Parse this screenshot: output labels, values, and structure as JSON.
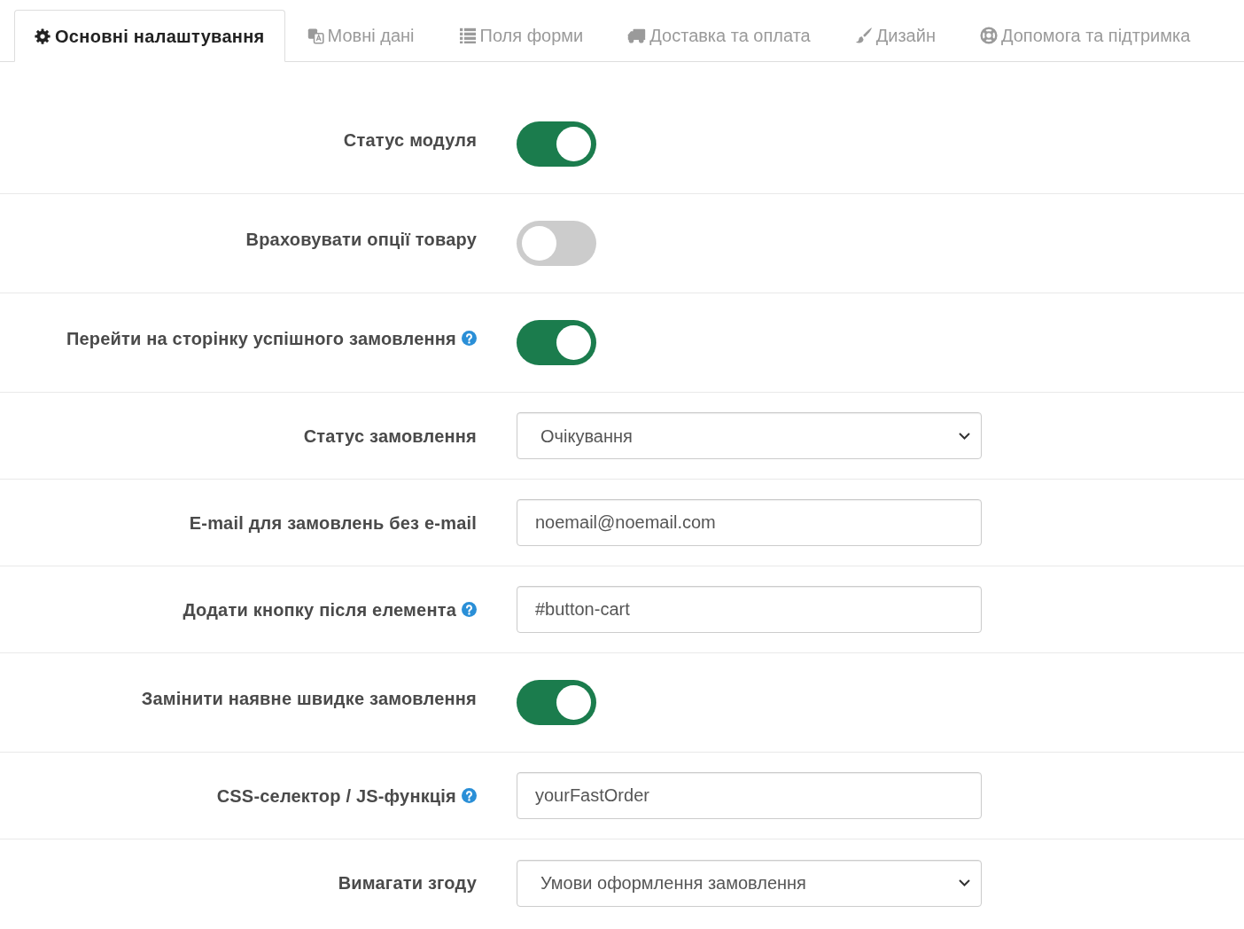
{
  "tabs": [
    {
      "label": "Основні налаштування",
      "selected": true
    },
    {
      "label": "Мовні дані",
      "selected": false
    },
    {
      "label": "Поля форми",
      "selected": false
    },
    {
      "label": "Доставка та оплата",
      "selected": false
    },
    {
      "label": "Дизайн",
      "selected": false
    },
    {
      "label": "Допомога та підтримка",
      "selected": false
    }
  ],
  "settings": [
    {
      "kind": "toggle",
      "label": "Статус модуля",
      "help": false,
      "on": true
    },
    {
      "kind": "toggle",
      "label": "Враховувати опції товару",
      "help": false,
      "on": false
    },
    {
      "kind": "toggle",
      "label": "Перейти на сторінку успішного замовлення",
      "help": true,
      "on": true
    },
    {
      "kind": "select",
      "label": "Статус замовлення",
      "help": false,
      "value": "Очікування"
    },
    {
      "kind": "text",
      "label": "E-mail для замовлень без e-mail",
      "help": false,
      "value": "noemail@noemail.com"
    },
    {
      "kind": "text",
      "label": "Додати кнопку після елемента",
      "help": true,
      "value": "#button-cart"
    },
    {
      "kind": "toggle",
      "label": "Замінити наявне швидке замовлення",
      "help": false,
      "on": true
    },
    {
      "kind": "text",
      "label": "CSS-селектор / JS-функція",
      "help": true,
      "value": "yourFastOrder"
    },
    {
      "kind": "select",
      "label": "Вимагати згоду",
      "help": false,
      "value": "Умови оформлення замовлення"
    }
  ]
}
